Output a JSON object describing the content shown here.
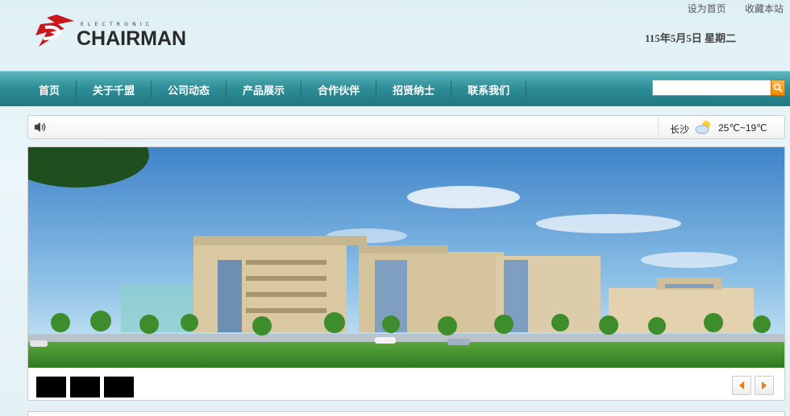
{
  "header": {
    "links": [
      "设为首页",
      "收藏本站"
    ],
    "logo_text": "CHAIRMAN",
    "logo_small": "ELECTRONIC",
    "date": "115年5月5日 星期二"
  },
  "nav": {
    "items": [
      "首页",
      "关于千盟",
      "公司动态",
      "产品展示",
      "合作伙伴",
      "招贤纳士",
      "联系我们"
    ],
    "search_placeholder": ""
  },
  "infobar": {
    "city": "长沙",
    "temperature": "25℃~19℃",
    "weather_icon": "partly-cloudy-icon",
    "speaker_icon": "speaker-icon"
  },
  "banner": {
    "thumbnail_count": 3,
    "prev_icon": "arrow-left-icon",
    "next_icon": "arrow-right-icon"
  },
  "colors": {
    "nav_top": "#5db6be",
    "nav_bottom": "#1f7880",
    "logo_red": "#c8181e",
    "search_orange": "#f08a00"
  }
}
